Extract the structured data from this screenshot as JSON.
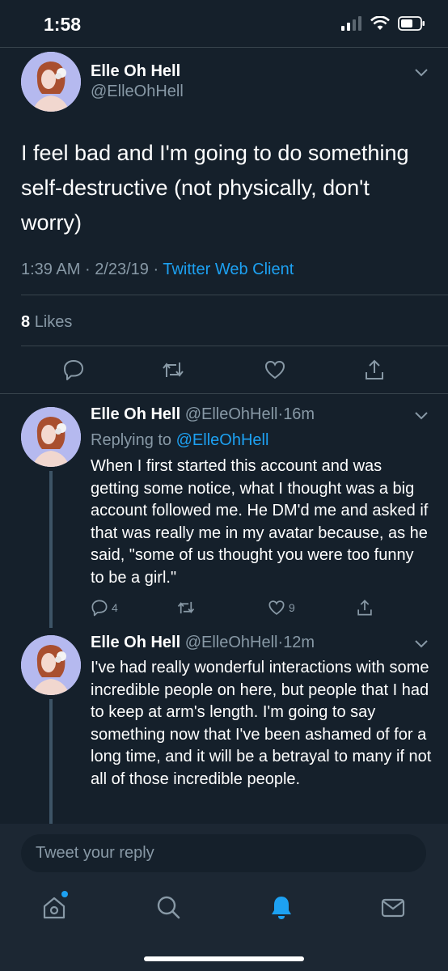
{
  "status": {
    "time": "1:58"
  },
  "main_tweet": {
    "name": "Elle Oh Hell",
    "handle": "@ElleOhHell",
    "text": "I feel bad and I'm going to do something self-destructive (not physically, don't worry)",
    "time": "1:39 AM",
    "date": "2/23/19",
    "separator": "·",
    "client": "Twitter Web Client",
    "likes_count": "8",
    "likes_label": "Likes"
  },
  "replies": [
    {
      "name": "Elle Oh Hell",
      "handle": "@ElleOhHell",
      "age": "16m",
      "replying_to_label": "Replying to",
      "replying_to_handle": "@ElleOhHell",
      "text": "When I first started this account and was getting some notice, what I thought was a big account followed me. He DM'd me and asked if that was really me in my avatar because, as he said, \"some of us thought you were too funny to be a girl.\"",
      "reply_count": "4",
      "like_count": "9"
    },
    {
      "name": "Elle Oh Hell",
      "handle": "@ElleOhHell",
      "age": "12m",
      "text": "I've had really wonderful interactions with some incredible people on here, but people that I had to keep at arm's length. I'm going to say something now that I've been ashamed of for a long time, and it will be a betrayal to many if not all of those incredible people."
    }
  ],
  "compose": {
    "placeholder": "Tweet your reply"
  },
  "tabs": [
    "home-icon",
    "search-icon",
    "bell-icon",
    "mail-icon"
  ],
  "colors": {
    "background": "#15202b",
    "accent": "#1da1f2",
    "muted": "#8899a6",
    "avatar_bg": "#b5b9ef"
  }
}
